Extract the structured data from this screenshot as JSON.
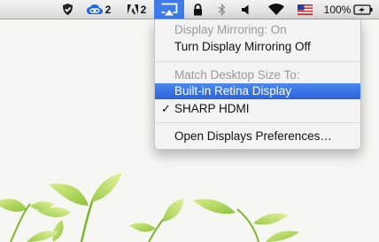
{
  "menubar": {
    "creative_cloud_count": "2",
    "adobe_count": "2",
    "battery_percent": "100%"
  },
  "display_menu": {
    "mirroring_status": "Display Mirroring: On",
    "toggle_mirroring": "Turn Display Mirroring Off",
    "match_header": "Match Desktop Size To:",
    "option_builtin": "Built-in Retina Display",
    "option_sharp": "SHARP HDMI",
    "check_mark": "✓",
    "open_prefs": "Open Displays Preferences…"
  },
  "colors": {
    "highlight": "#3e7be8",
    "leaf_green": "#8fc43a"
  }
}
